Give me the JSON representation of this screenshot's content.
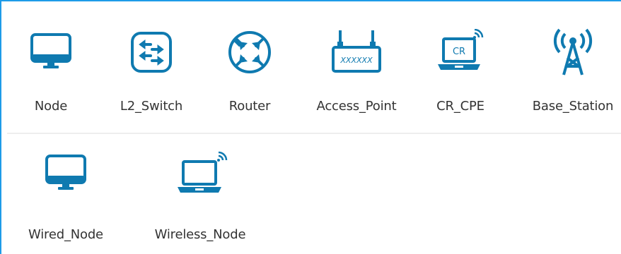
{
  "palette": {
    "icon_stroke": "#0f7ab0",
    "frame_border": "#1e9be8",
    "label_text": "#333333",
    "divider": "#eeeeee"
  },
  "devices_row1": [
    {
      "label": "Node",
      "icon": "monitor-icon"
    },
    {
      "label": "L2_Switch",
      "icon": "switch-icon"
    },
    {
      "label": "Router",
      "icon": "router-icon"
    },
    {
      "label": "Access_Point",
      "icon": "access-point-icon"
    },
    {
      "label": "CR_CPE",
      "icon": "cr-laptop-icon",
      "icon_text": "CR"
    },
    {
      "label": "Base_Station",
      "icon": "cell-tower-icon"
    }
  ],
  "devices_row2": [
    {
      "label": "Wired_Node",
      "icon": "monitor-icon"
    },
    {
      "label": "Wireless_Node",
      "icon": "wireless-laptop-icon"
    }
  ],
  "access_point_text": "XXXXXX"
}
